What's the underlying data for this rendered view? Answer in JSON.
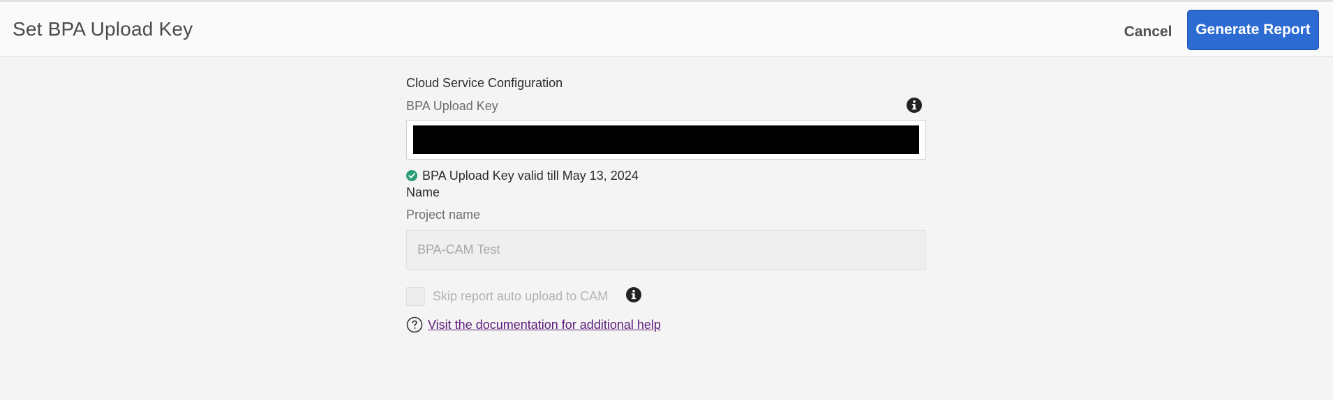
{
  "header": {
    "title": "Set BPA Upload Key",
    "cancel_label": "Cancel",
    "generate_label": "Generate Report"
  },
  "form": {
    "section_label": "Cloud Service Configuration",
    "upload_key_label": "BPA Upload Key",
    "upload_key_value": "",
    "validity_text": "BPA Upload Key valid till May 13, 2024",
    "name_label": "Name",
    "project_label": "Project name",
    "project_value": "BPA-CAM Test",
    "skip_label": "Skip report auto upload to CAM",
    "skip_checked": false,
    "help_link": "Visit the documentation for additional help"
  },
  "colors": {
    "primary": "#2c6bd1",
    "success": "#2d9d78",
    "link": "#5a1a78"
  },
  "icons": {
    "info": "info-icon",
    "valid": "check-circle-icon",
    "help": "question-circle-icon"
  }
}
